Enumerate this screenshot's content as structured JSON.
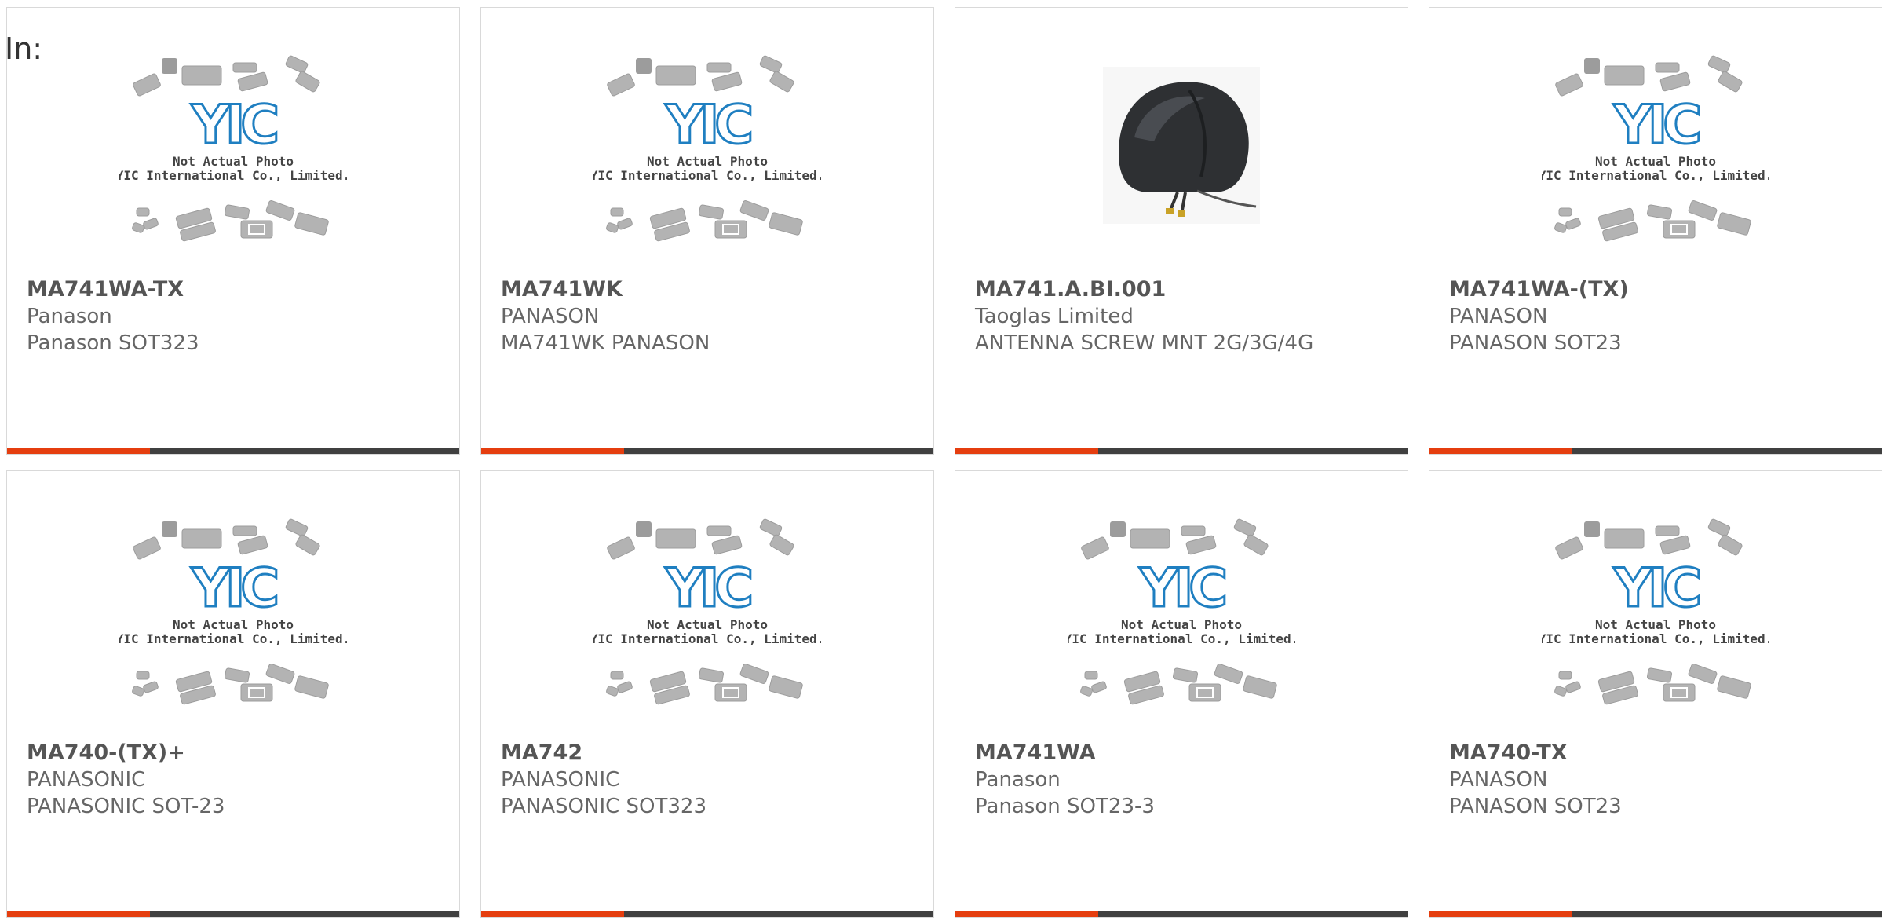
{
  "filter_label": "In:",
  "colors": {
    "accent": "#e53e0f",
    "bar": "#404040",
    "logo_blue": "#1f7fc1",
    "text_dark": "#555555",
    "text_light": "#666666"
  },
  "placeholder": {
    "line1": "Not Actual Photo",
    "line2": "YIC International Co., Limited.",
    "logo_text": "YIC"
  },
  "products": [
    {
      "part_number": "MA741WA-TX",
      "manufacturer": "Panason",
      "description": "Panason SOT323",
      "image": "placeholder"
    },
    {
      "part_number": "MA741WK",
      "manufacturer": "PANASON",
      "description": "MA741WK PANASON",
      "image": "placeholder"
    },
    {
      "part_number": "MA741.A.BI.001",
      "manufacturer": "Taoglas Limited",
      "description": "ANTENNA SCREW MNT 2G/3G/4G",
      "image": "antenna-photo"
    },
    {
      "part_number": "MA741WA-(TX)",
      "manufacturer": "PANASON",
      "description": "PANASON SOT23",
      "image": "placeholder"
    },
    {
      "part_number": "MA740-(TX)+",
      "manufacturer": "PANASONIC",
      "description": "PANASONIC SOT-23",
      "image": "placeholder"
    },
    {
      "part_number": "MA742",
      "manufacturer": "PANASONIC",
      "description": "PANASONIC SOT323",
      "image": "placeholder"
    },
    {
      "part_number": "MA741WA",
      "manufacturer": "Panason",
      "description": "Panason SOT23-3",
      "image": "placeholder"
    },
    {
      "part_number": "MA740-TX",
      "manufacturer": "PANASON",
      "description": "PANASON SOT23",
      "image": "placeholder"
    }
  ]
}
